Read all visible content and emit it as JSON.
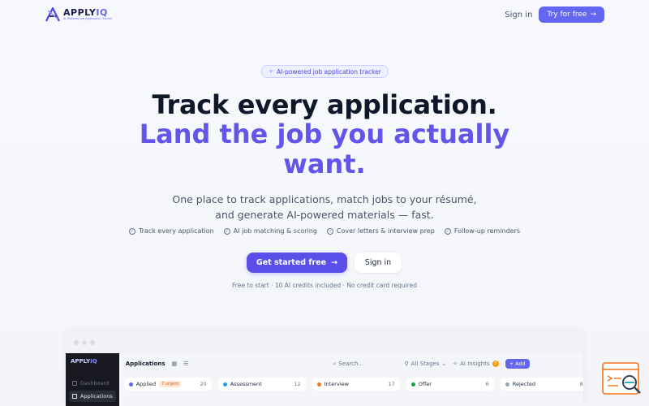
{
  "header": {
    "logo_text": "APPLY",
    "logo_text_accent": "IQ",
    "logo_tagline": "AI-Powered Job Application Tracker",
    "signin_label": "Sign in",
    "try_label": "Try for free"
  },
  "hero": {
    "badge": "AI-powered job application tracker",
    "title_line1": "Track every application.",
    "title_line2": "Land the job you actually want.",
    "subtitle": "One place to track applications, match jobs to your résumé, and generate AI-powered materials — fast.",
    "features": [
      "Track every application",
      "AI job matching & scoring",
      "Cover letters & interview prep",
      "Follow-up reminders"
    ],
    "cta_primary": "Get started free",
    "cta_secondary": "Sign in",
    "fineprint": "Free to start · 10 AI credits included · No credit card required"
  },
  "preview": {
    "sidebar_logo": "APPLY",
    "sidebar_logo_accent": "IQ",
    "sidebar_items": [
      "Dashboard",
      "Applications"
    ],
    "page_title": "Applications",
    "search_placeholder": "Search...",
    "stages_label": "All Stages",
    "insights_label": "AI Insights",
    "insights_count": "3",
    "add_label": "+ Add",
    "columns": [
      {
        "label": "Applied",
        "tag": "7 urgent",
        "count": "20",
        "color": "#6366f1"
      },
      {
        "label": "Assessment",
        "count": "12",
        "color": "#0ea5e9"
      },
      {
        "label": "Interview",
        "count": "17",
        "color": "#f97316"
      },
      {
        "label": "Offer",
        "count": "6",
        "color": "#16a34a"
      },
      {
        "label": "Rejected",
        "count": "8",
        "color": "#94a3b8"
      }
    ]
  },
  "colors": {
    "accent": "#6366f1",
    "title_dark": "#0f172a",
    "title_accent": "#6355ea"
  }
}
